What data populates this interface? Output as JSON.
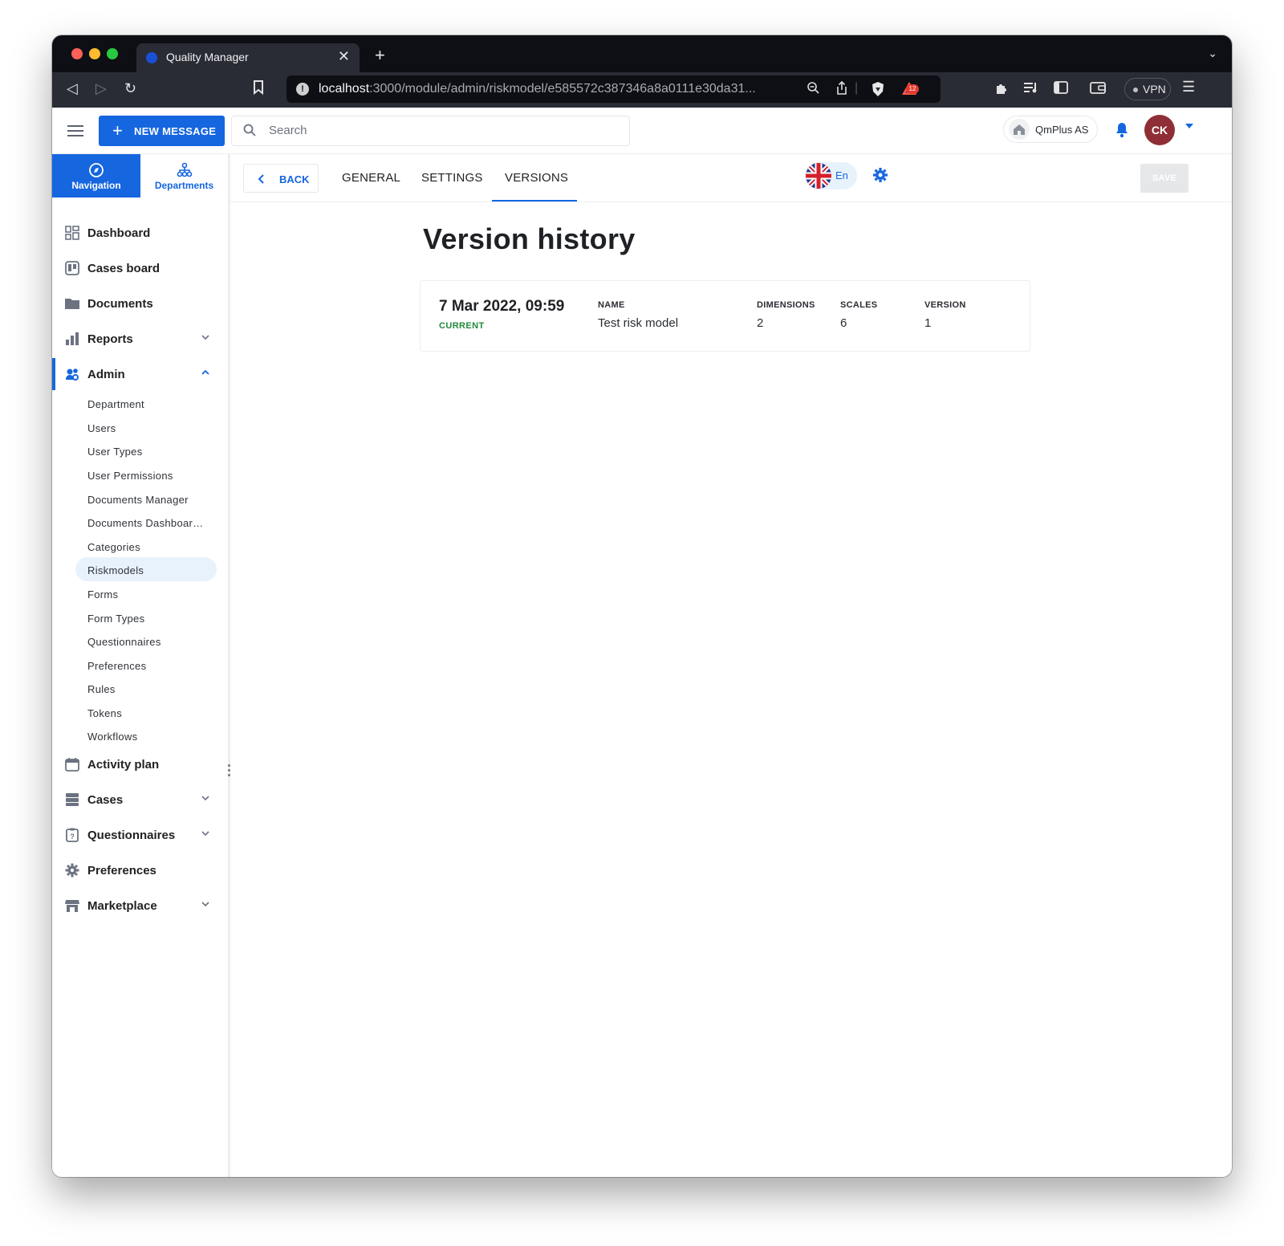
{
  "browser": {
    "tab_title": "Quality Manager",
    "url_host": "localhost",
    "url_rest": ":3000/module/admin/riskmodel/e585572c387346a8a0111e30da31...",
    "vpn_label": "VPN",
    "brave_badge": "12"
  },
  "header": {
    "new_message_label": "NEW MESSAGE",
    "search_placeholder": "Search",
    "org_name": "QmPlus AS",
    "avatar_initials": "CK"
  },
  "sidebar": {
    "tabs": [
      {
        "label": "Navigation",
        "icon": "compass-icon"
      },
      {
        "label": "Departments",
        "icon": "org-chart-icon"
      }
    ],
    "items": [
      {
        "label": "Dashboard",
        "icon": "dashboard-icon"
      },
      {
        "label": "Cases board",
        "icon": "board-icon"
      },
      {
        "label": "Documents",
        "icon": "folder-icon"
      },
      {
        "label": "Reports",
        "icon": "bar-chart-icon"
      },
      {
        "label": "Admin",
        "icon": "admin-icon"
      },
      {
        "label": "Activity plan",
        "icon": "calendar-icon"
      },
      {
        "label": "Cases",
        "icon": "cases-icon"
      },
      {
        "label": "Questionnaires",
        "icon": "questionnaire-icon"
      },
      {
        "label": "Preferences",
        "icon": "gear-icon"
      },
      {
        "label": "Marketplace",
        "icon": "store-icon"
      }
    ],
    "admin_sub": [
      "Department",
      "Users",
      "User Types",
      "User Permissions",
      "Documents Manager",
      "Documents Dashboar…",
      "Categories",
      "Riskmodels",
      "Forms",
      "Form Types",
      "Questionnaires",
      "Preferences",
      "Rules",
      "Tokens",
      "Workflows"
    ]
  },
  "toolbar": {
    "back_label": "BACK",
    "tabs": [
      "GENERAL",
      "SETTINGS",
      "VERSIONS"
    ],
    "active_tab": "VERSIONS",
    "language_code": "En",
    "save_label": "SAVE"
  },
  "main": {
    "title": "Version history",
    "versions": [
      {
        "date": "7 Mar 2022, 09:59",
        "status": "CURRENT",
        "name_header": "NAME",
        "name": "Test risk model",
        "dimensions_header": "DIMENSIONS",
        "dimensions": "2",
        "scales_header": "SCALES",
        "scales": "6",
        "version_header": "VERSION",
        "version": "1"
      }
    ]
  },
  "colors": {
    "primary": "#1666e0",
    "current_green": "#1f8a3a",
    "avatar": "#8f2f35"
  }
}
